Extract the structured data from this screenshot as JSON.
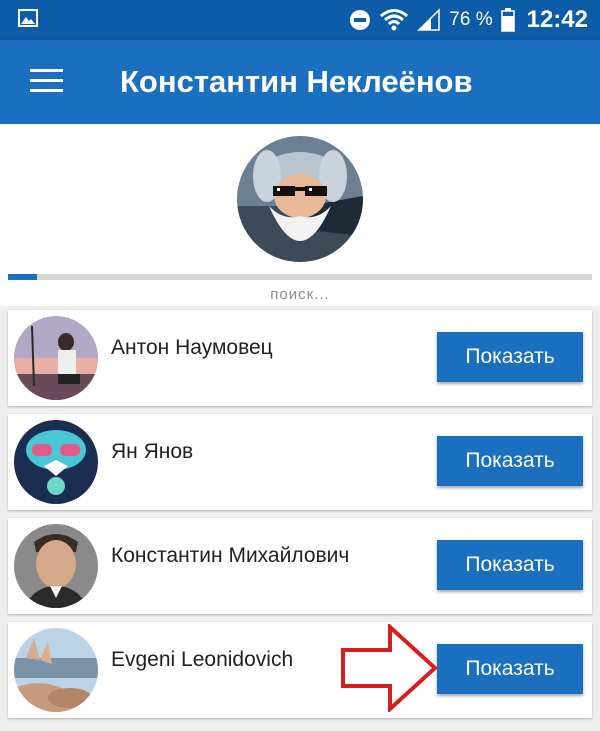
{
  "status_bar": {
    "battery_percent": "76 %",
    "time": "12:42",
    "icons": [
      "gallery-icon",
      "do-not-disturb-icon",
      "wifi-icon",
      "signal-icon",
      "battery-icon"
    ]
  },
  "app_bar": {
    "title": "Константин Неклеёнов",
    "menu_icon": "hamburger-menu-icon",
    "color": "#1a6fbe"
  },
  "profile": {
    "progress_fraction": 0.05,
    "search_label": "поиск..."
  },
  "contacts": [
    {
      "name": "Антон Наумовец",
      "button": "Показать"
    },
    {
      "name": "Ян Янов",
      "button": "Показать"
    },
    {
      "name": "Константин Михайлович",
      "button": "Показать"
    },
    {
      "name": "Evgeni Leonidovich",
      "button": "Показать"
    }
  ],
  "annotation": {
    "arrow_color": "#d81e1e"
  }
}
